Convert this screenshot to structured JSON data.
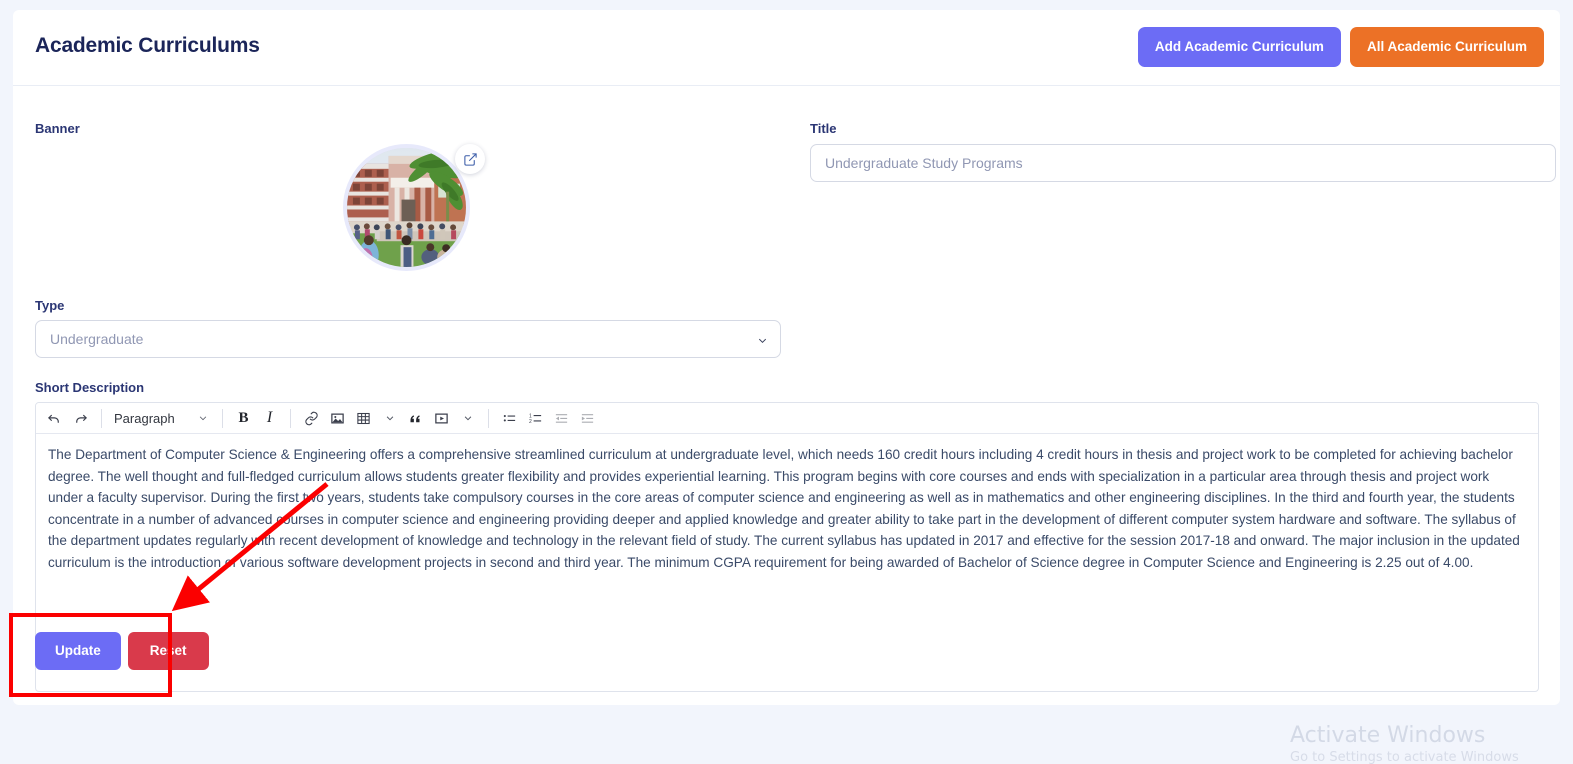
{
  "header": {
    "title": "Academic Curriculums",
    "buttons": [
      {
        "label": "Add Academic Curriculum",
        "color": "#6c6cf5",
        "name": "add-academic-curriculum-button"
      },
      {
        "label": "All Academic Curriculum",
        "color": "#ec7126",
        "name": "all-academic-curriculum-button"
      }
    ]
  },
  "form": {
    "banner": {
      "label": "Banner",
      "edit_icon": "edit-pencil-icon"
    },
    "title": {
      "label": "Title",
      "value": "Undergraduate Study Programs",
      "placeholder": "Undergraduate Study Programs"
    },
    "type": {
      "label": "Type",
      "value": "Undergraduate",
      "chevron_icon": "chevron-down-icon",
      "options": [
        "Undergraduate"
      ]
    },
    "short_description": {
      "label": "Short Description",
      "toolbar": {
        "undo": "undo-icon",
        "redo": "redo-icon",
        "block_format": "Paragraph",
        "bold": "B",
        "italic": "I",
        "link": "link-icon",
        "image": "image-icon",
        "table": "table-icon",
        "blockquote": "blockquote-icon",
        "media": "media-icon",
        "bullet_list": "bullet-list-icon",
        "numbered_list": "numbered-list-icon",
        "outdent": "outdent-icon",
        "indent": "indent-icon"
      },
      "content": "The Department of Computer Science & Engineering offers a comprehensive streamlined curriculum at undergraduate level, which needs 160 credit hours including 4 credit hours in thesis and project work to be completed for achieving bachelor degree. The well thought and full-fledged curriculum allows students greater flexibility and provides experiential learning. This program begins with core courses and ends with specialization in a particular area through thesis and project work under a faculty supervisor. During the first two years, students take compulsory courses in the core areas of computer science and engineering as well as in mathematics and other engineering disciplines. In the third and fourth year, the students concentrate in a number of advanced courses in computer science and engineering providing deeper and applied knowledge and greater ability to take part in the development of different computer system hardware and software. The syllabus of the department updates regularly with recent development of knowledge and technology in the relevant field of study. The current syllabus has updated in 2017 and effective for the session 2017-18 and onward. The major inclusion in the updated curriculum is the introduction of various software development projects in second and third year. The minimum CGPA requirement for being awarded of Bachelor of Science degree in Computer Science and Engineering is 2.25 out of 4.00."
    },
    "actions": {
      "update_label": "Update",
      "reset_label": "Reset",
      "update_color": "#6c6cf5",
      "reset_color": "#d93a4b"
    }
  },
  "annotation": {
    "color": "#fb0000",
    "shape": "rectangle-with-arrow",
    "target": "form-action-buttons"
  },
  "watermark": {
    "title": "Activate Windows",
    "subtitle": "Go to Settings to activate Windows"
  }
}
